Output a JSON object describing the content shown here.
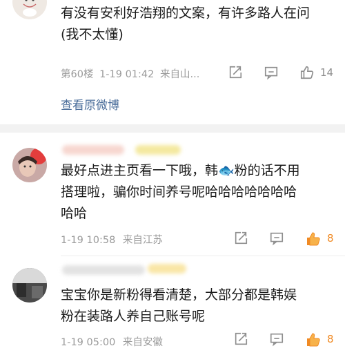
{
  "comments": [
    {
      "text_lines": [
        "有没有安利好浩翔的文案，有许多路人在问",
        "(我不太懂)"
      ],
      "floor": "第60楼",
      "time": "1-19 01:42",
      "source": "来自山...",
      "likes": "14",
      "liked": false,
      "view_original": "查看原微博"
    },
    {
      "text_lines": [
        "最好点进主页看一下哦，韩🐟粉的话不用",
        "搭理啦，骗你时间养号呢哈哈哈哈哈哈哈",
        "哈哈"
      ],
      "time": "1-19 10:58",
      "source": "来自江苏",
      "likes": "8",
      "liked": true
    },
    {
      "text_lines": [
        "宝宝你是新粉得看清楚，大部分都是韩娱",
        "粉在装路人养自己账号呢"
      ],
      "time": "1-19 05:00",
      "source": "来自安徽",
      "likes": "8",
      "liked": true
    }
  ],
  "colors": {
    "meta": "#9a9a9a",
    "link": "#4a6d9a",
    "liked": "#f08a24",
    "icon": "#8e8e8e"
  },
  "icons": [
    "share-icon",
    "comment-icon",
    "like-icon"
  ]
}
